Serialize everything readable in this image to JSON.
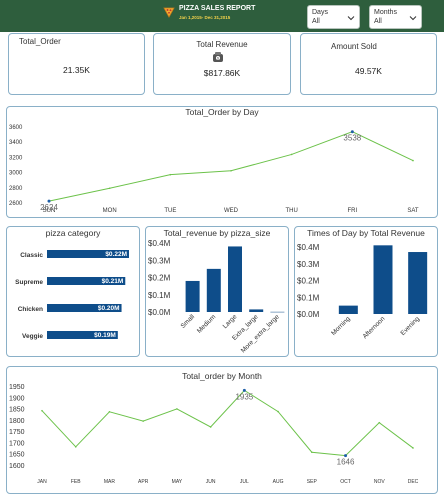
{
  "header": {
    "title": "PIZZA SALES REPORT",
    "subtitle": "Jan 1,2015- Dec 31,2015",
    "bg_color": "#2e5e3d",
    "subtitle_color": "#f2d24b",
    "icon": "pizza-icon"
  },
  "slicers": {
    "days": {
      "label": "Days",
      "value": "All"
    },
    "months": {
      "label": "Months",
      "value": "All"
    }
  },
  "kpis": {
    "total_order": {
      "label": "Total_Order",
      "value": "21.35K"
    },
    "total_revenue": {
      "label": "Total Revenue",
      "value": "$817.86K",
      "icon": "money-bag-icon"
    },
    "amount_sold": {
      "label": "Amount Sold",
      "value": "49.57K"
    }
  },
  "chart_data": [
    {
      "id": "orders_by_day",
      "type": "line",
      "title": "Total_Order by Day",
      "categories": [
        "SUN",
        "MON",
        "TUE",
        "WED",
        "THU",
        "FRI",
        "SAT"
      ],
      "values": [
        2624,
        2794,
        2973,
        3024,
        3239,
        3538,
        3158
      ],
      "data_labels": [
        {
          "index": 0,
          "text": "2624"
        },
        {
          "index": 5,
          "text": "3538"
        }
      ],
      "yticks": [
        "3600",
        "3400",
        "3200",
        "3000",
        "2800",
        "2600"
      ],
      "ylim": [
        2600,
        3600
      ],
      "color": "#6cc24a"
    },
    {
      "id": "pizza_category",
      "type": "bar",
      "orientation": "horizontal",
      "title": "pizza category",
      "categories": [
        "Classic",
        "Supreme",
        "Chicken",
        "Veggie"
      ],
      "values": [
        0.22,
        0.21,
        0.2,
        0.19
      ],
      "value_labels": [
        "$0.22M",
        "$0.21M",
        "$0.20M",
        "$0.19M"
      ],
      "unit": "M",
      "color": "#0e4d8a"
    },
    {
      "id": "revenue_by_size",
      "type": "bar",
      "title": "Total_revenue by pizza_size",
      "categories": [
        "Small",
        "Medium",
        "Large",
        "Extra_large",
        "More_extra_large"
      ],
      "values": [
        0.18,
        0.25,
        0.38,
        0.015,
        0.001
      ],
      "yticks": [
        "$0.4M",
        "$0.3M",
        "$0.2M",
        "$0.1M",
        "$0.0M"
      ],
      "ylim": [
        0,
        0.4
      ],
      "unit": "M",
      "color": "#0e4d8a"
    },
    {
      "id": "revenue_by_time",
      "type": "bar",
      "title": "Times of Day by Total Revenue",
      "categories": [
        "Morning",
        "Afternoon",
        "Evening"
      ],
      "values": [
        0.05,
        0.41,
        0.37
      ],
      "yticks": [
        "$0.4M",
        "$0.3M",
        "$0.2M",
        "$0.1M",
        "$0.0M"
      ],
      "ylim": [
        0,
        0.4
      ],
      "unit": "M",
      "color": "#0e4d8a"
    },
    {
      "id": "orders_by_month",
      "type": "line",
      "title": "Total_order by Month",
      "categories": [
        "JAN",
        "FEB",
        "MAR",
        "APR",
        "MAY",
        "JUN",
        "JUL",
        "AUG",
        "SEP",
        "OCT",
        "NOV",
        "DEC"
      ],
      "values": [
        1845,
        1685,
        1840,
        1799,
        1853,
        1773,
        1935,
        1841,
        1661,
        1646,
        1792,
        1680
      ],
      "data_labels": [
        {
          "index": 6,
          "text": "1935"
        },
        {
          "index": 9,
          "text": "1646"
        }
      ],
      "yticks": [
        "1950",
        "1900",
        "1850",
        "1800",
        "1750",
        "1700",
        "1650",
        "1600"
      ],
      "ylim": [
        1600,
        1950
      ],
      "color": "#6cc24a"
    }
  ]
}
